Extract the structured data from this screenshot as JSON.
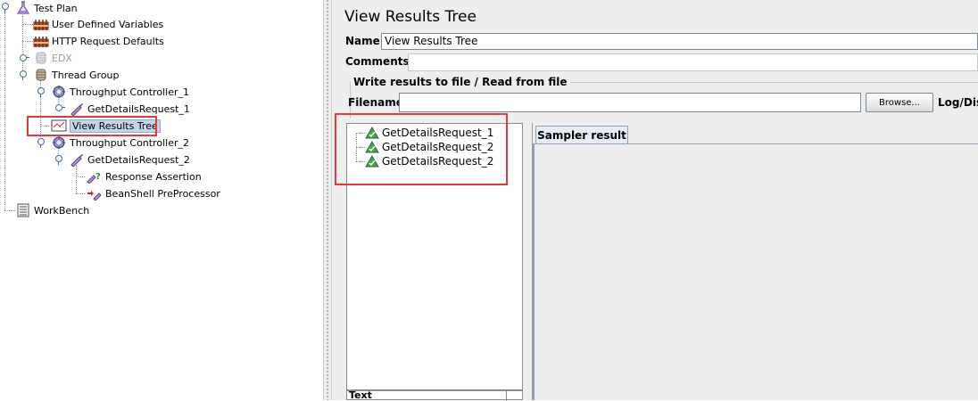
{
  "tree": {
    "items": [
      {
        "label": "Test Plan",
        "icon": "flask-icon"
      },
      {
        "label": "User Defined Variables",
        "icon": "config-element-icon"
      },
      {
        "label": "HTTP Request Defaults",
        "icon": "config-element-icon"
      },
      {
        "label": "EDX",
        "icon": "thread-group-icon"
      },
      {
        "label": "Thread Group",
        "icon": "thread-group-icon"
      },
      {
        "label": "Throughput Controller_1",
        "icon": "controller-icon"
      },
      {
        "label": "GetDetailsRequest_1",
        "icon": "sampler-icon"
      },
      {
        "label": "View Results Tree",
        "icon": "listener-icon"
      },
      {
        "label": "Throughput Controller_2",
        "icon": "controller-icon"
      },
      {
        "label": "GetDetailsRequest_2",
        "icon": "sampler-icon"
      },
      {
        "label": "Response Assertion",
        "icon": "assertion-icon"
      },
      {
        "label": "BeanShell PreProcessor",
        "icon": "preprocessor-icon"
      },
      {
        "label": "WorkBench",
        "icon": "workbench-icon"
      }
    ]
  },
  "panel": {
    "title": "View Results Tree",
    "name_label": "Name:",
    "name_value": "View Results Tree",
    "comments_label": "Comments:",
    "file_group_title": "Write results to file / Read from file",
    "filename_label": "Filename",
    "filename_value": "",
    "browse_label": "Browse...",
    "log_label": "Log/Disp"
  },
  "results": {
    "items": [
      {
        "label": "GetDetailsRequest_1",
        "icon": "success-triangle-icon"
      },
      {
        "label": "GetDetailsRequest_2",
        "icon": "success-triangle-icon"
      },
      {
        "label": "GetDetailsRequest_2",
        "icon": "success-triangle-icon"
      }
    ],
    "bottom_text": "Text"
  },
  "tabs": {
    "sampler_result": "Sampler result"
  },
  "colors": {
    "highlight": "#e23a3a",
    "selection": "#c5d4e6",
    "panel_bg": "#eeeeee"
  }
}
